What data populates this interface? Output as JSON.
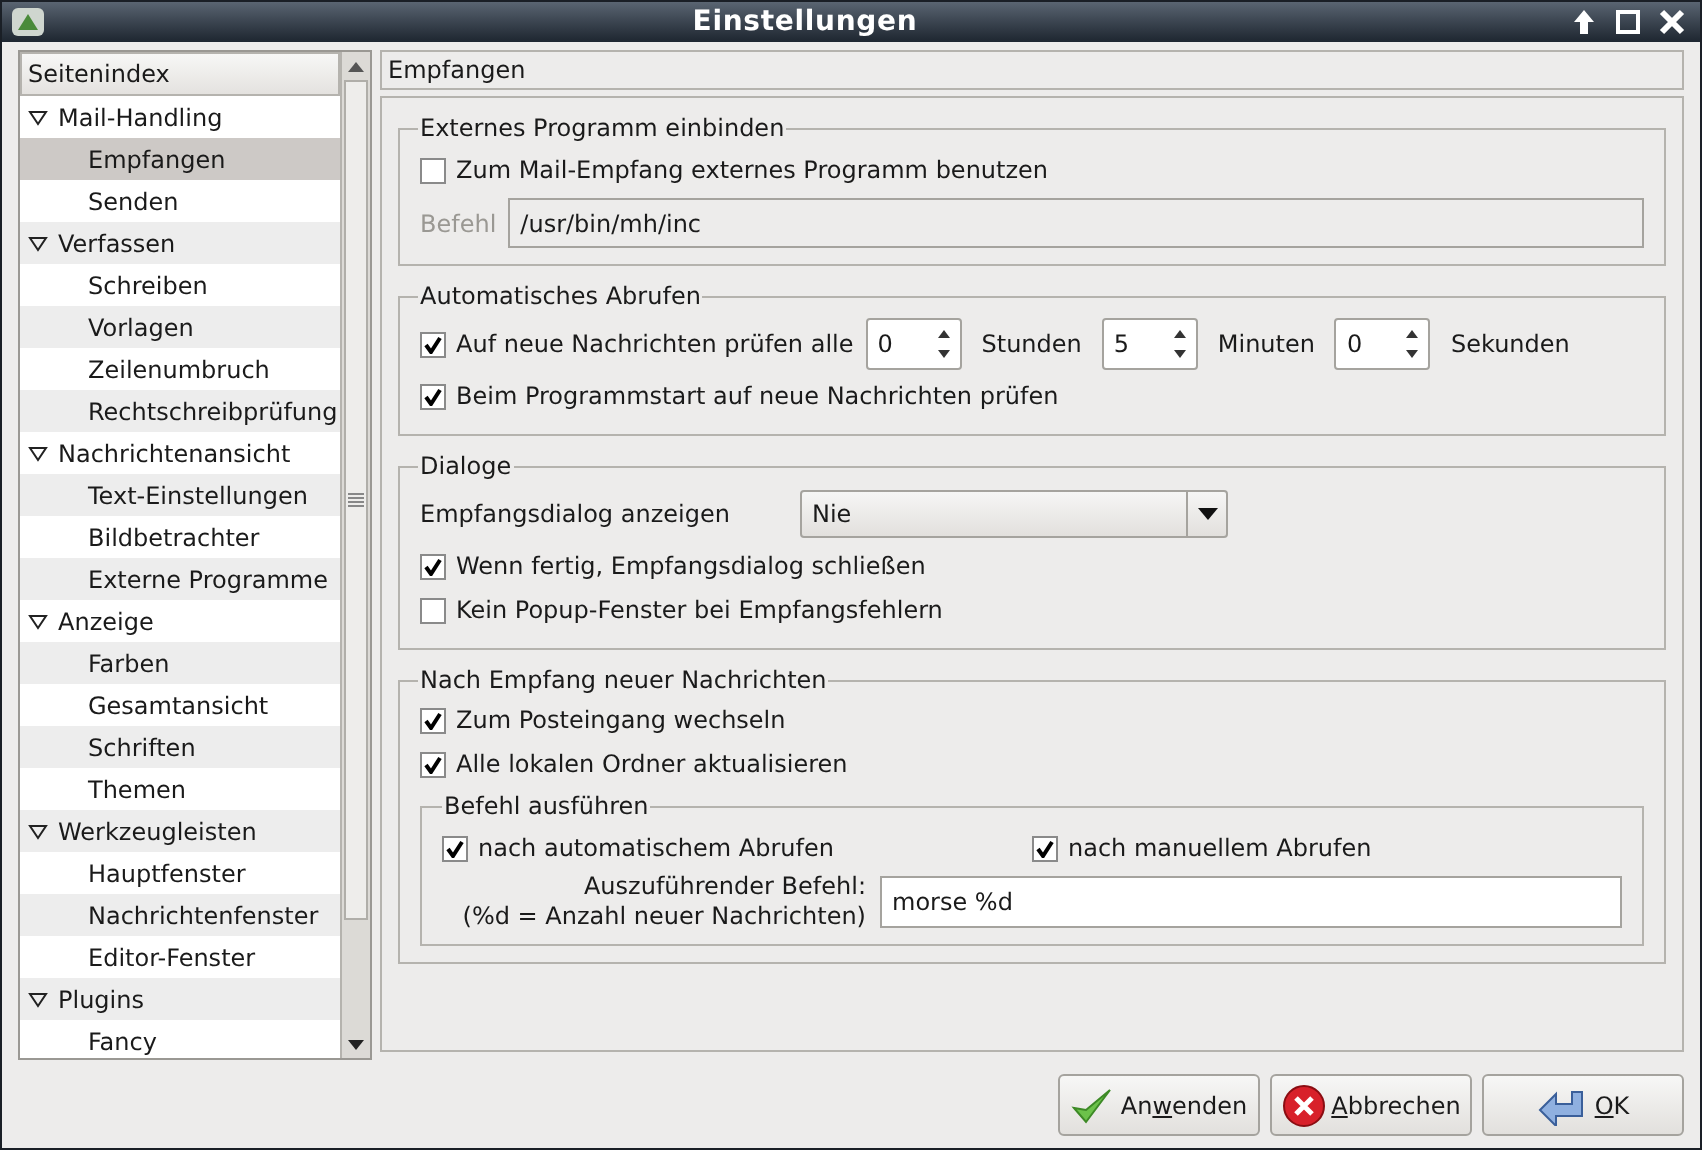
{
  "window": {
    "title": "Einstellungen"
  },
  "sidebar": {
    "header": "Seitenindex",
    "items": [
      {
        "label": "Mail-Handling",
        "expanded": true,
        "selected": false,
        "children": [
          {
            "label": "Empfangen",
            "selected": true
          },
          {
            "label": "Senden",
            "selected": false
          }
        ]
      },
      {
        "label": "Verfassen",
        "expanded": true,
        "selected": false,
        "children": [
          {
            "label": "Schreiben",
            "selected": false
          },
          {
            "label": "Vorlagen",
            "selected": false
          },
          {
            "label": "Zeilenumbruch",
            "selected": false
          },
          {
            "label": "Rechtschreibprüfung",
            "selected": false
          }
        ]
      },
      {
        "label": "Nachrichtenansicht",
        "expanded": true,
        "selected": false,
        "children": [
          {
            "label": "Text-Einstellungen",
            "selected": false
          },
          {
            "label": "Bildbetrachter",
            "selected": false
          },
          {
            "label": "Externe Programme",
            "selected": false
          }
        ]
      },
      {
        "label": "Anzeige",
        "expanded": true,
        "selected": false,
        "children": [
          {
            "label": "Farben",
            "selected": false
          },
          {
            "label": "Gesamtansicht",
            "selected": false
          },
          {
            "label": "Schriften",
            "selected": false
          },
          {
            "label": "Themen",
            "selected": false
          }
        ]
      },
      {
        "label": "Werkzeugleisten",
        "expanded": true,
        "selected": false,
        "children": [
          {
            "label": "Hauptfenster",
            "selected": false
          },
          {
            "label": "Nachrichtenfenster",
            "selected": false
          },
          {
            "label": "Editor-Fenster",
            "selected": false
          }
        ]
      },
      {
        "label": "Plugins",
        "expanded": true,
        "selected": false,
        "children": [
          {
            "label": "Fancy",
            "selected": false
          }
        ]
      }
    ]
  },
  "page": {
    "title": "Empfangen",
    "external": {
      "title": "Externes Programm einbinden",
      "checkbox": {
        "label": "Zum Mail-Empfang externes Programm benutzen",
        "checked": false
      },
      "command_label": "Befehl",
      "command_value": "/usr/bin/mh/inc",
      "disabled": true
    },
    "auto": {
      "title": "Automatisches Abrufen",
      "check": {
        "label": "Auf neue Nachrichten prüfen alle",
        "checked": true
      },
      "spins": [
        {
          "value": "0",
          "unit": "Stunden"
        },
        {
          "value": "5",
          "unit": "Minuten"
        },
        {
          "value": "0",
          "unit": "Sekunden"
        }
      ],
      "startup": {
        "label": "Beim Programmstart auf neue Nachrichten prüfen",
        "checked": true
      }
    },
    "dialogs": {
      "title": "Dialoge",
      "select_label": "Empfangsdialog anzeigen",
      "select_value": "Nie",
      "checks": [
        {
          "label": "Wenn fertig, Empfangsdialog schließen",
          "checked": true
        },
        {
          "label": "Kein Popup-Fenster bei Empfangsfehlern",
          "checked": false
        }
      ]
    },
    "after": {
      "title": "Nach Empfang neuer Nachrichten",
      "checks": [
        {
          "label": "Zum Posteingang wechseln",
          "checked": true
        },
        {
          "label": "Alle lokalen Ordner aktualisieren",
          "checked": true
        }
      ],
      "run": {
        "title": "Befehl ausführen",
        "checks": [
          {
            "label": "nach automatischem Abrufen",
            "checked": true
          },
          {
            "label": "nach manuellem Abrufen",
            "checked": true
          }
        ],
        "command_label": [
          "Auszuführender Befehl:",
          "(%d = Anzahl neuer Nachrichten)"
        ],
        "command_value": "morse %d"
      }
    }
  },
  "buttons": [
    {
      "kind": "apply",
      "before": "An",
      "accel": "w",
      "after": "enden"
    },
    {
      "kind": "cancel",
      "accel": "A",
      "after": "bbrechen"
    },
    {
      "kind": "ok",
      "accel": "O",
      "after": "K"
    }
  ]
}
